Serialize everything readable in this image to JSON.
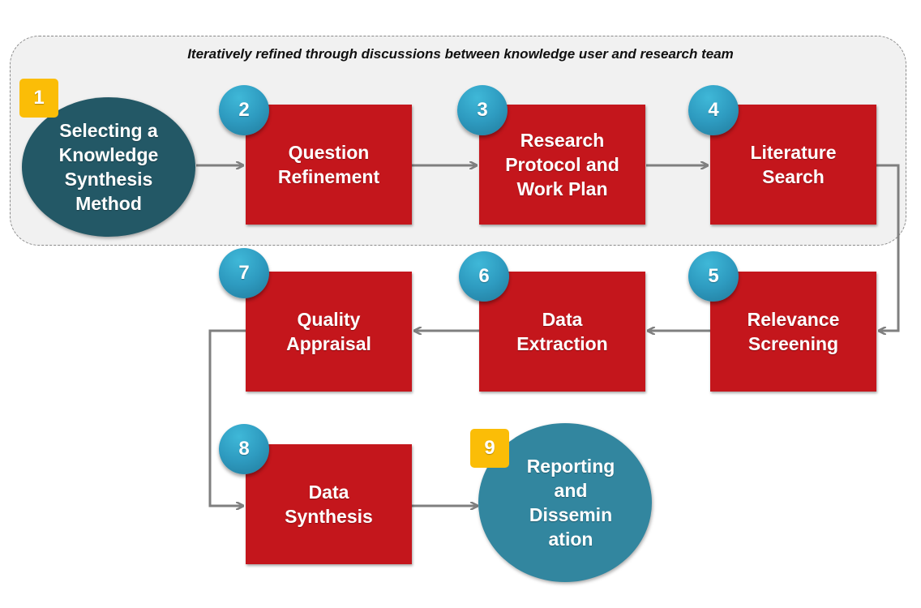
{
  "group_label": "Iteratively refined through discussions between knowledge user and research team",
  "colors": {
    "step_box": "#c4161c",
    "start_circle": "#235866",
    "end_circle": "#32869f",
    "number_badge": "#2e9bc0",
    "square_badge": "#fbbd07",
    "arrow": "#7f7f7f"
  },
  "steps": [
    {
      "number": "1",
      "label": "Selecting a\nKnowledge\nSynthesis\nMethod",
      "shape": "circle"
    },
    {
      "number": "2",
      "label": "Question\nRefinement",
      "shape": "box"
    },
    {
      "number": "3",
      "label": "Research\nProtocol  and\nWork Plan",
      "shape": "box"
    },
    {
      "number": "4",
      "label": "Literature\nSearch",
      "shape": "box"
    },
    {
      "number": "5",
      "label": "Relevance\nScreening",
      "shape": "box"
    },
    {
      "number": "6",
      "label": "Data\nExtraction",
      "shape": "box"
    },
    {
      "number": "7",
      "label": "Quality\nAppraisal",
      "shape": "box"
    },
    {
      "number": "8",
      "label": "Data\nSynthesis",
      "shape": "box"
    },
    {
      "number": "9",
      "label": "Reporting\nand\nDissemin\nation",
      "shape": "circle"
    }
  ],
  "flow": [
    [
      "1",
      "2"
    ],
    [
      "2",
      "3"
    ],
    [
      "3",
      "4"
    ],
    [
      "4",
      "5"
    ],
    [
      "5",
      "6"
    ],
    [
      "6",
      "7"
    ],
    [
      "7",
      "8"
    ],
    [
      "8",
      "9"
    ]
  ]
}
